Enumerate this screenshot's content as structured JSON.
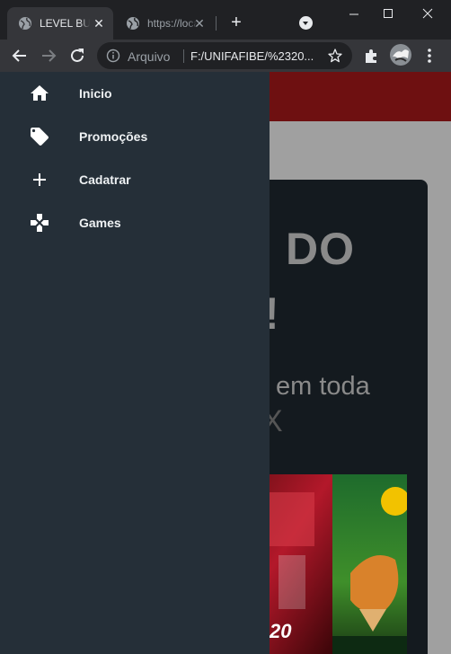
{
  "browser": {
    "tabs": [
      {
        "label": "LEVEL BUGS",
        "active": true
      },
      {
        "label": "https://localhost",
        "active": false
      }
    ],
    "omnibox": {
      "scheme_label": "Arquivo",
      "url": "F:/UNIFAFIBE/%2320..."
    }
  },
  "drawer": {
    "items": [
      {
        "label": "Inicio",
        "icon": "home-icon"
      },
      {
        "label": "Promoções",
        "icon": "tag-icon"
      },
      {
        "label": "Cadatrar",
        "icon": "plus-icon"
      },
      {
        "label": "Games",
        "icon": "gamepad-icon"
      }
    ]
  },
  "page": {
    "hero_title": "DO",
    "hero_exclaim": "!",
    "hero_subtitle": "em toda",
    "hero_subtitle2": "X"
  },
  "colors": {
    "drawer_bg": "#252f38",
    "header_bar": "#6e1011",
    "hero_bg": "#141a1f"
  }
}
